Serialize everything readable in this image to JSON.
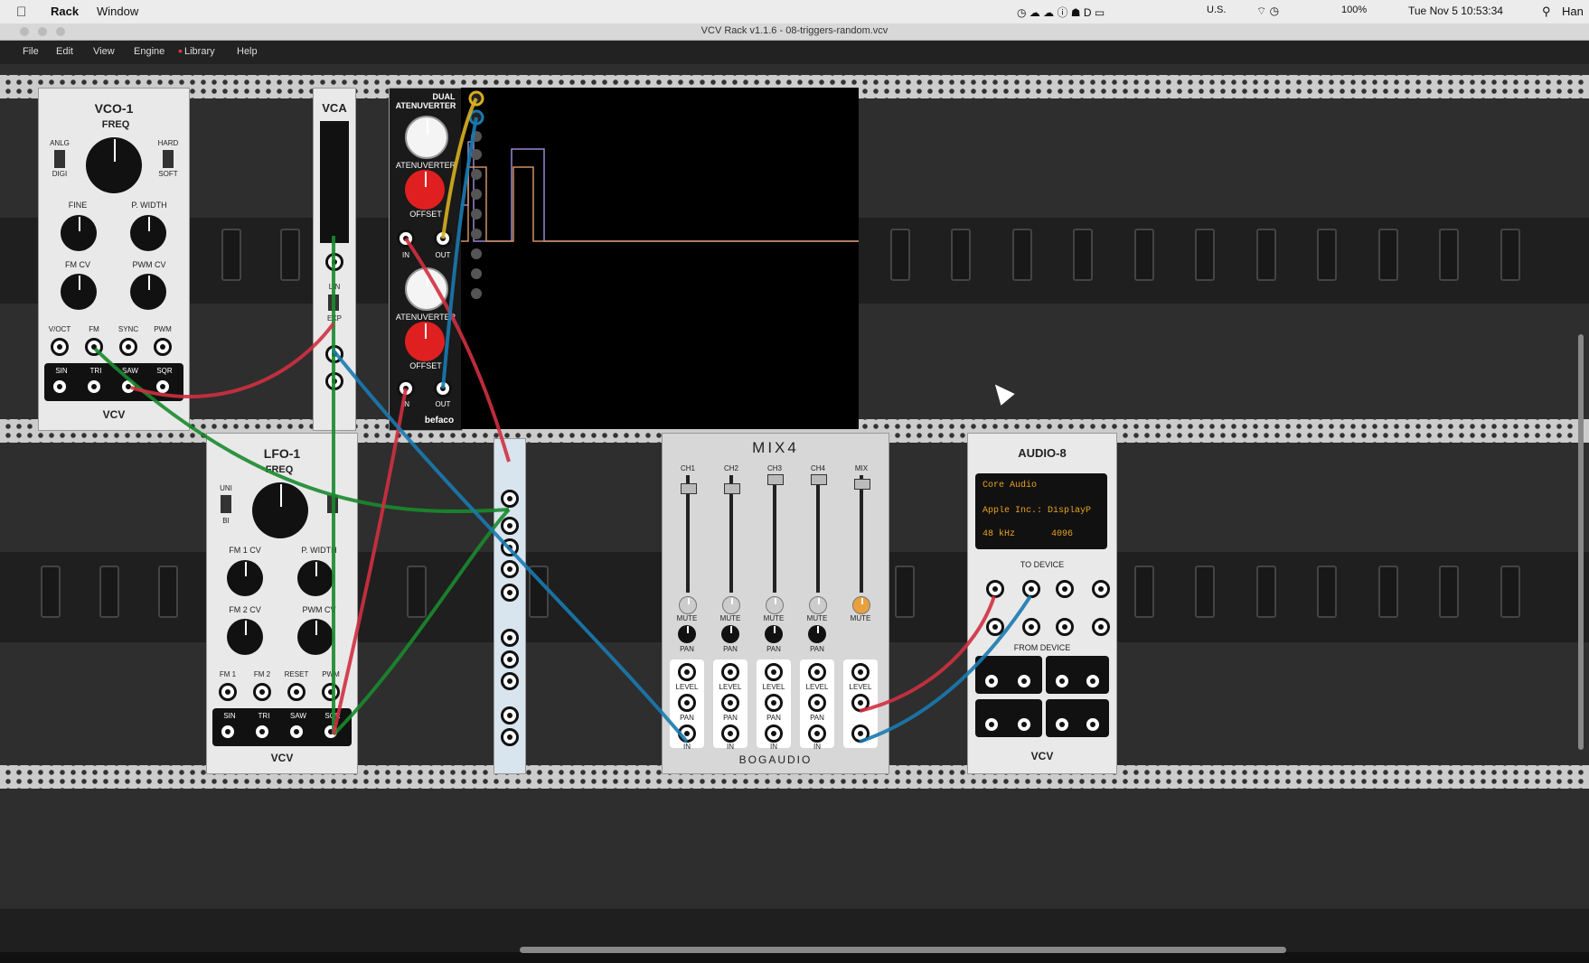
{
  "mac_menu": {
    "app": "Rack",
    "window": "Window",
    "keyboard": "U.S.",
    "battery": "100%",
    "clock": "Tue Nov 5  10:53:34",
    "user": "Han"
  },
  "window": {
    "title": "VCV Rack v1.1.6 - 08-triggers-random.vcv"
  },
  "menu": {
    "items": [
      "File",
      "Edit",
      "View",
      "Engine",
      "Library",
      "Help"
    ]
  },
  "modules": {
    "vco": {
      "title": "VCO-1",
      "freq": "FREQ",
      "anlg": "ANLG",
      "digi": "DIGI",
      "hard": "HARD",
      "soft": "SOFT",
      "fine": "FINE",
      "pwidth": "P. WIDTH",
      "fmcv": "FM CV",
      "pwmcv": "PWM CV",
      "voct": "V/OCT",
      "fm": "FM",
      "sync": "SYNC",
      "pwm": "PWM",
      "sin": "SIN",
      "tri": "TRI",
      "saw": "SAW",
      "sqr": "SQR",
      "brand": "VCV"
    },
    "vca": {
      "title": "VCA",
      "lin": "LIN",
      "exp": "EXP"
    },
    "atten": {
      "title_top": "DUAL",
      "title": "ATENUVERTER",
      "offset": "OFFSET",
      "in": "IN",
      "out": "OUT",
      "brand": "befaco"
    },
    "lfo": {
      "title": "LFO-1",
      "freq": "FREQ",
      "uni": "UNI",
      "bi": "BI",
      "fm1cv": "FM 1 CV",
      "pwidth": "P. WIDTH",
      "fm2cv": "FM 2 CV",
      "pwmcv": "PWM CV",
      "fm1": "FM 1",
      "fm2": "FM 2",
      "reset": "RESET",
      "pwm": "PWM",
      "sin": "SIN",
      "tri": "TRI",
      "saw": "SAW",
      "sqr": "SQR",
      "brand": "VCV"
    },
    "mixer": {
      "title": "MIX4",
      "channels": [
        "CH1",
        "CH2",
        "CH3",
        "CH4",
        "MIX"
      ],
      "mute": "MUTE",
      "pan": "PAN",
      "level": "LEVEL",
      "in": "IN",
      "brand": "BOGAUDIO"
    },
    "audio": {
      "title": "AUDIO-8",
      "driver": "Core Audio",
      "device": "Apple Inc.: DisplayP",
      "rate": "48 kHz",
      "block": "4096",
      "to_device": "TO DEVICE",
      "from_device": "FROM DEVICE",
      "brand": "VCV"
    }
  },
  "colors": {
    "cable_green": "#1a8a2e",
    "cable_red": "#d03040",
    "cable_blue": "#1a7ab0",
    "cable_yellow": "#d8b020",
    "trace_purple": "#9a88d0",
    "trace_orange": "#d09060"
  }
}
